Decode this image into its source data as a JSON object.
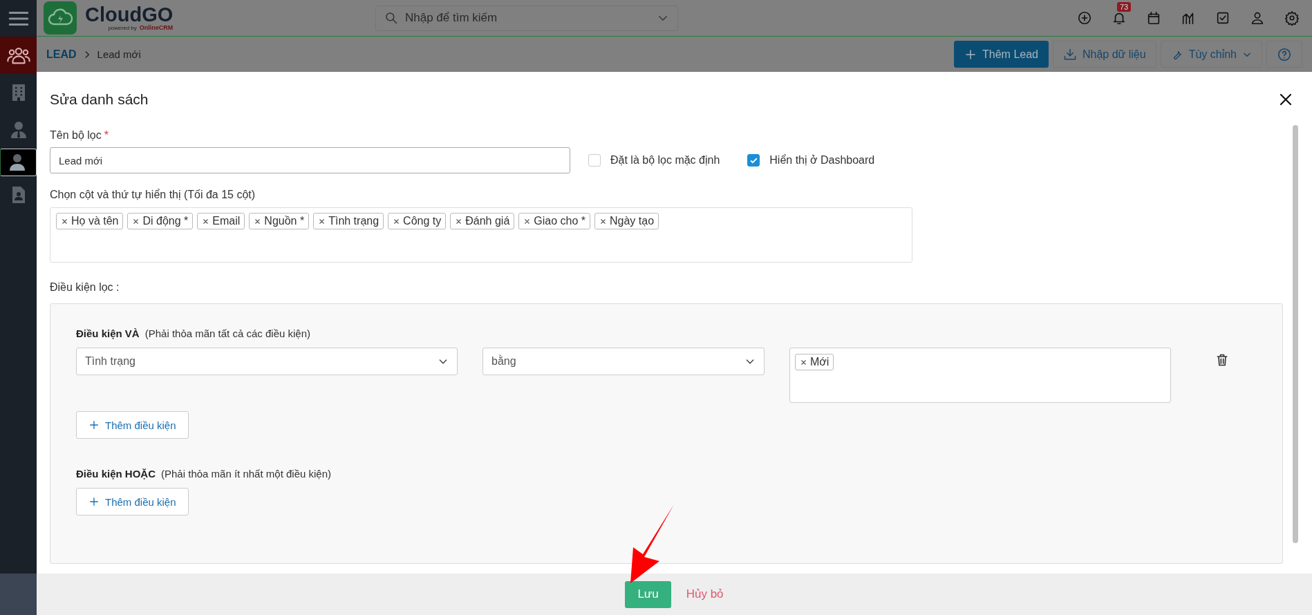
{
  "sidebar": {
    "items": [
      {
        "kind": "people",
        "active": true,
        "selected": false
      },
      {
        "kind": "building",
        "active": false,
        "selected": false
      },
      {
        "kind": "agent",
        "active": false,
        "selected": false
      },
      {
        "kind": "person",
        "active": false,
        "selected": true
      },
      {
        "kind": "contact",
        "active": false,
        "selected": false
      }
    ]
  },
  "topbar": {
    "logo": {
      "name": "CloudGO",
      "tagline": "powered by",
      "brand": "OnlineCRM"
    },
    "search": {
      "placeholder": "Nhập để tìm kiếm"
    },
    "notification_count": "73"
  },
  "breadcrumb": {
    "module": "LEAD",
    "current": "Lead mới"
  },
  "actions": [
    {
      "kind": "primary",
      "label": "Thêm Lead"
    },
    {
      "kind": "import",
      "label": "Nhập dữ liệu"
    },
    {
      "kind": "dropdown",
      "label": "Tùy chỉnh"
    },
    {
      "kind": "help"
    }
  ],
  "modal": {
    "title": "Sửa danh sách",
    "name_field": {
      "label": "Tên bộ lọc",
      "required_mark": "*",
      "value": "Lead mới"
    },
    "checkboxes": [
      {
        "label": "Đặt là bộ lọc mặc định",
        "checked": false
      },
      {
        "label": "Hiển thị ở Dashboard",
        "checked": true
      }
    ],
    "columns": {
      "label": "Chọn cột và thứ tự hiển thị (Tối đa 15 cột)",
      "tags": [
        "Họ và tên",
        "Di động *",
        "Email",
        "Nguồn *",
        "Tình trạng",
        "Công ty",
        "Đánh giá",
        "Giao cho *",
        "Ngày tạo"
      ]
    },
    "filter_label": "Điều kiện lọc :",
    "groups": [
      {
        "title": "Điều kiện VÀ",
        "hint": "(Phải thỏa mãn tất cả các điều kiện)",
        "conditions": [
          {
            "field": "Tình trạng",
            "operator": "bằng",
            "values": [
              "Mới"
            ]
          }
        ],
        "add_button": "Thêm điều kiện"
      },
      {
        "title": "Điều kiện HOẶC",
        "hint": "(Phải thỏa mãn ít nhất một điều kiện)",
        "add_button": "Thêm điều kiện"
      }
    ],
    "footer": {
      "save": "Lưu",
      "cancel": "Hủy bỏ"
    }
  }
}
